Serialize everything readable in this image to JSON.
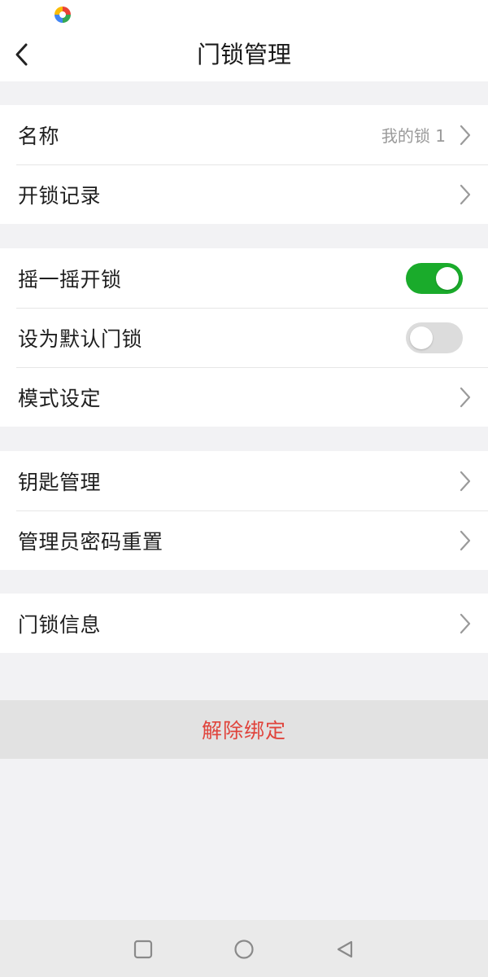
{
  "header": {
    "title": "门锁管理"
  },
  "group1": {
    "name_label": "名称",
    "name_value": "我的锁 1",
    "unlock_records_label": "开锁记录"
  },
  "group2": {
    "shake_unlock_label": "摇一摇开锁",
    "shake_unlock_enabled": true,
    "default_lock_label": "设为默认门锁",
    "default_lock_enabled": false,
    "mode_settings_label": "模式设定"
  },
  "group3": {
    "key_management_label": "钥匙管理",
    "admin_password_reset_label": "管理员密码重置"
  },
  "group4": {
    "lock_info_label": "门锁信息"
  },
  "unbind": {
    "label": "解除绑定",
    "color": "#e0443c"
  },
  "colors": {
    "toggle_on": "#1aab2b",
    "toggle_off": "#dcdcdc"
  },
  "icons": {
    "back": "back-arrow-icon",
    "chevron": "chevron-right-icon",
    "nav_recent": "square-icon",
    "nav_home": "circle-icon",
    "nav_back": "triangle-back-icon"
  }
}
